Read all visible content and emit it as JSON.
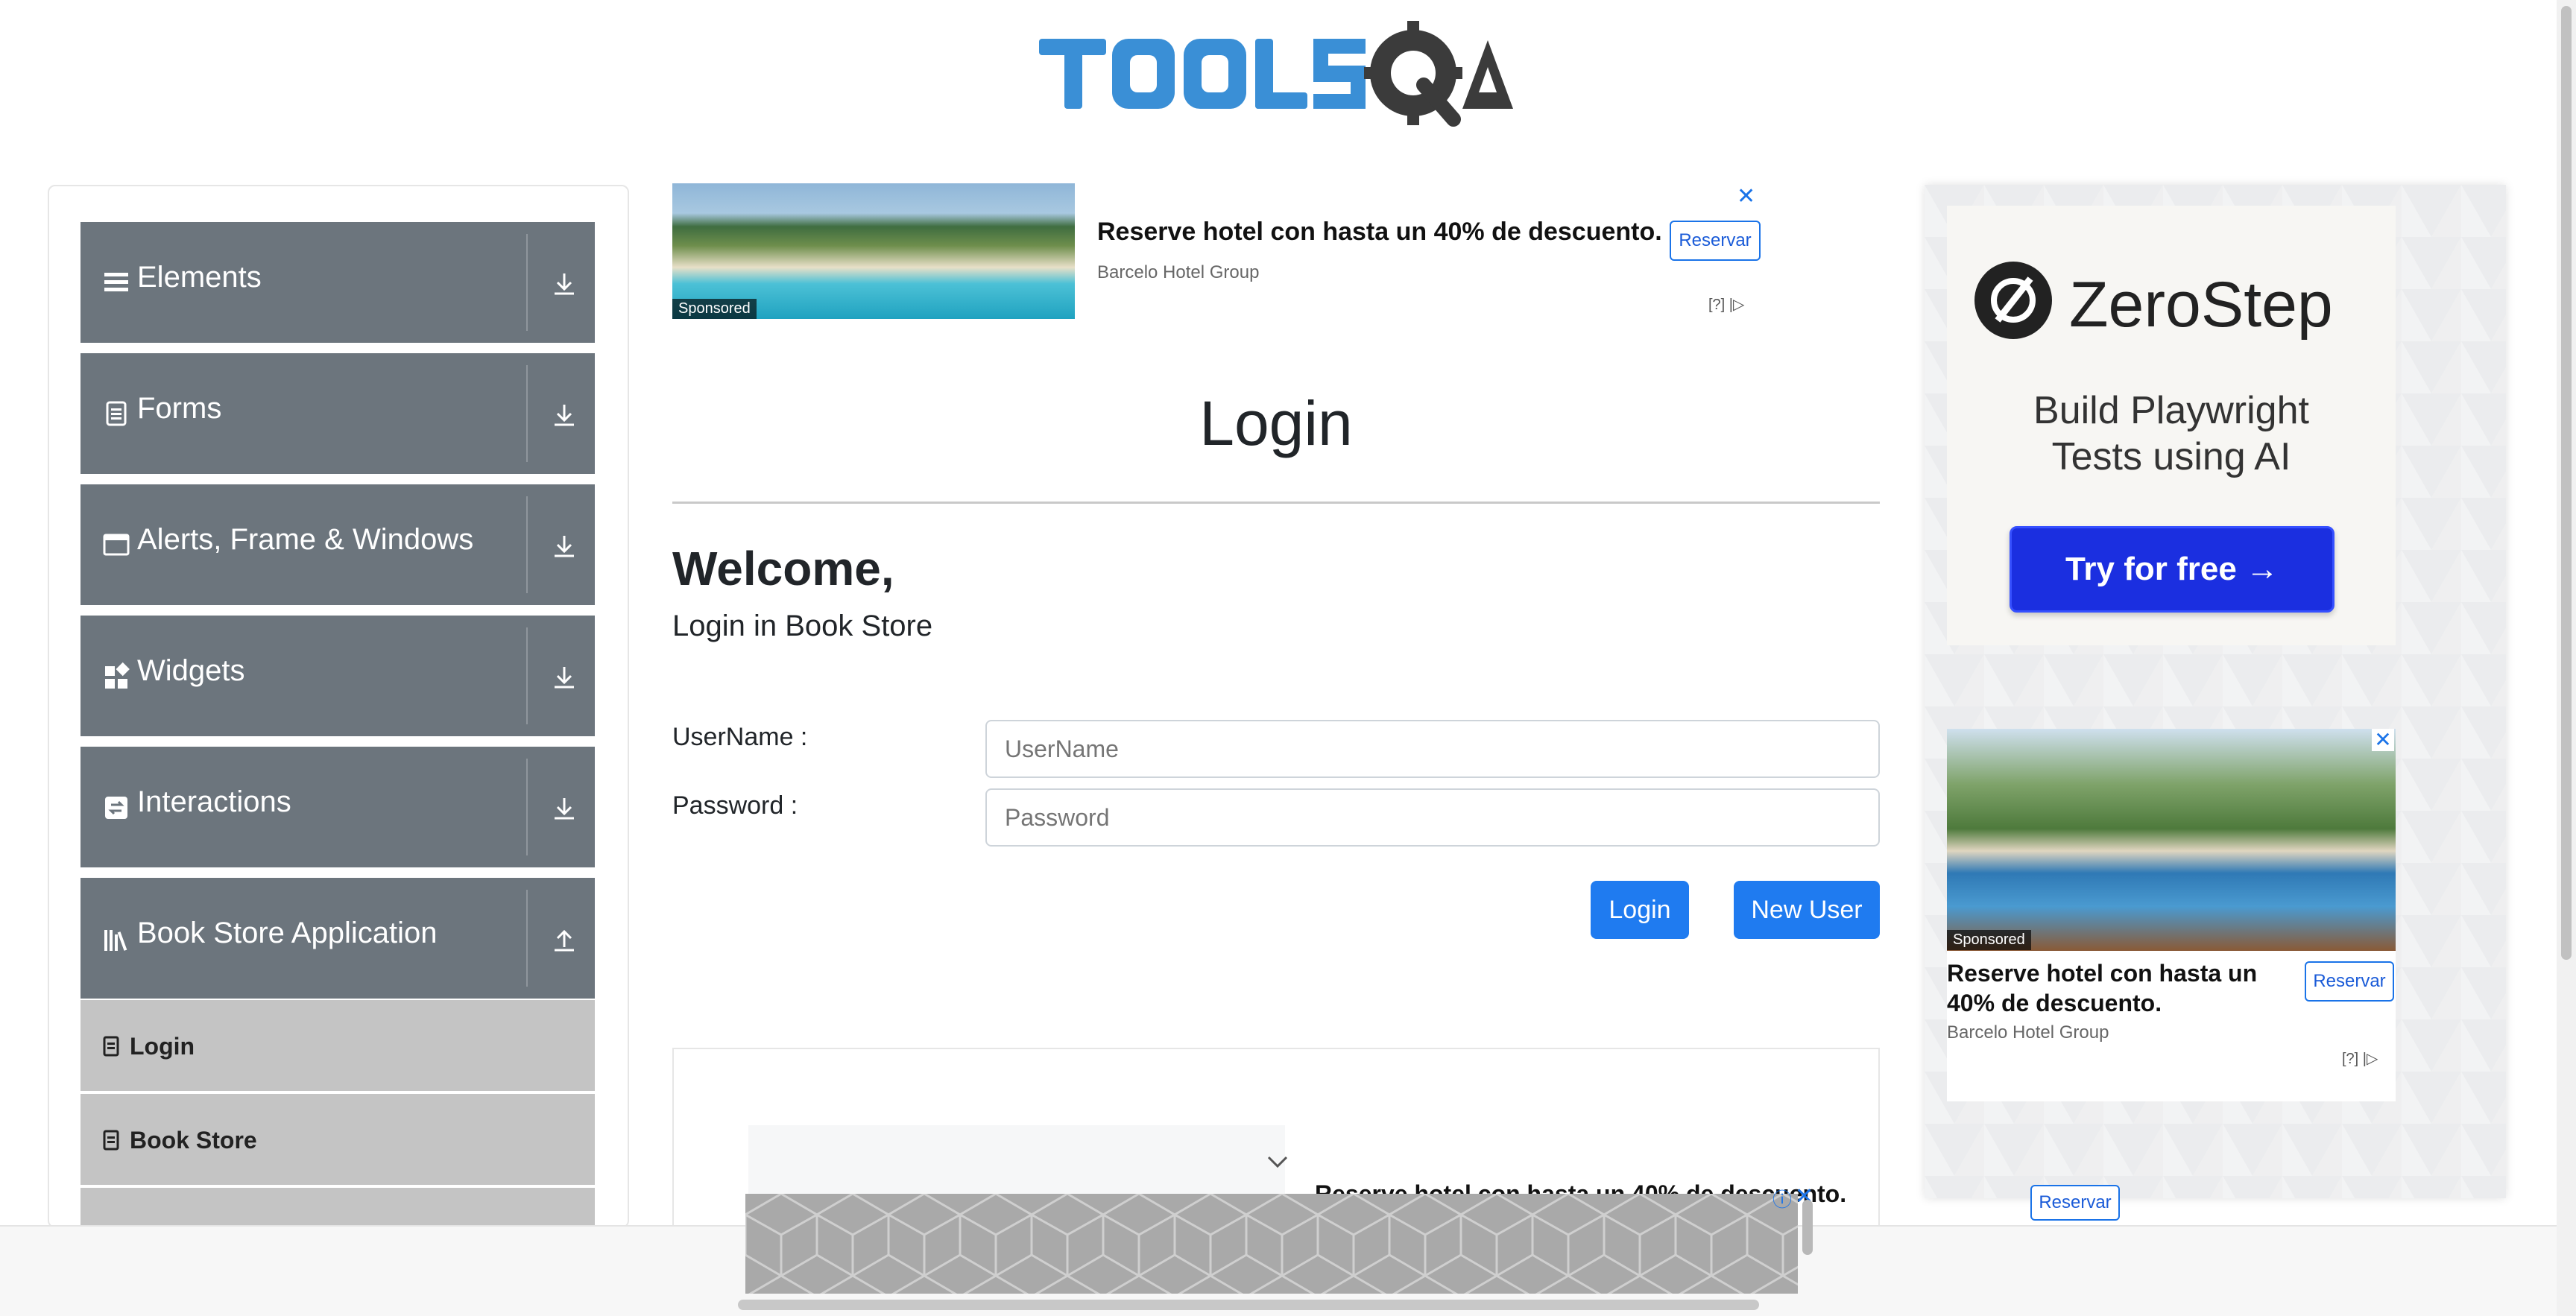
{
  "logo": {
    "text": "TOOLSQA"
  },
  "sidebar": {
    "groups": [
      {
        "label": "Elements",
        "icon": "menu-icon",
        "expanded": false
      },
      {
        "label": "Forms",
        "icon": "document-icon",
        "expanded": false
      },
      {
        "label": "Alerts, Frame & Windows",
        "icon": "window-icon",
        "expanded": false
      },
      {
        "label": "Widgets",
        "icon": "widgets-icon",
        "expanded": false
      },
      {
        "label": "Interactions",
        "icon": "interactions-icon",
        "expanded": false
      },
      {
        "label": "Book Store Application",
        "icon": "library-icon",
        "expanded": true
      }
    ],
    "subitems": [
      {
        "label": "Login"
      },
      {
        "label": "Book Store"
      }
    ]
  },
  "top_ad": {
    "title": "Reserve hotel con hasta un 40% de descuento.",
    "advertiser": "Barcelo Hotel Group",
    "button": "Reservar",
    "sponsored": "Sponsored",
    "info": "[?]",
    "close": "✕"
  },
  "main": {
    "page_title": "Login",
    "welcome": "Welcome,",
    "subtitle": "Login in Book Store",
    "username_label": "UserName :",
    "username_placeholder": "UserName",
    "password_label": "Password :",
    "password_placeholder": "Password",
    "login_button": "Login",
    "new_user_button": "New User"
  },
  "lower_ad": {
    "text": "Reserve hotel con hasta un 40% de descuento.",
    "button": "Reservar"
  },
  "right_ad": {
    "brand": "ZeroStep",
    "tagline_line1": "Build Playwright",
    "tagline_line2": "Tests using AI",
    "cta": "Try for free →"
  },
  "right_hotel_ad": {
    "sponsored": "Sponsored",
    "title": "Reserve hotel con hasta un 40% de descuento.",
    "advertiser": "Barcelo Hotel Group",
    "button": "Reservar",
    "info": "[?]",
    "close": "✕"
  },
  "colors": {
    "sidebar_group": "#6c757d",
    "sidebar_subitem": "#c4c4c4",
    "primary_button": "#1f7bf0",
    "logo_blue": "#3a8fd6",
    "logo_dark": "#3b3b3b",
    "zerostep_button": "#1b2fe0"
  }
}
